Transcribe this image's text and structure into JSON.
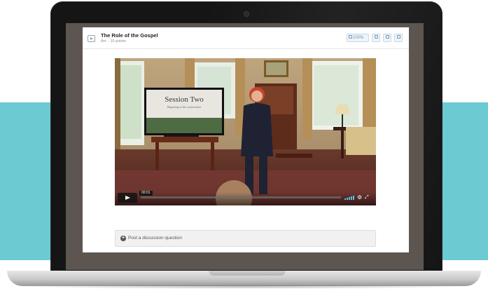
{
  "colors": {
    "teal_band": "#6ccad3",
    "laptop_bezel": "#151515",
    "accent_blue": "#6b96bb",
    "volume_blue": "#4fc3e6"
  },
  "lesson": {
    "title": "The Role of the Gospel",
    "duration": "8m",
    "separator": "·",
    "points": "10 points",
    "icon": "video-icon"
  },
  "toolbar": {
    "zoom_label": "100%",
    "zoom_icon": "expand-icon",
    "buttons": [
      "notes-icon",
      "bookmark-icon",
      "layout-icon"
    ]
  },
  "video": {
    "slide_title": "Session Two",
    "slide_subtitle": "Beginning of the conversation",
    "current_time": "00:01",
    "progress": 0.0,
    "volume_icon": "volume-icon",
    "settings_icon": "gear-icon",
    "fullscreen_icon": "fullscreen-icon"
  },
  "discussion": {
    "placeholder": "Post a discussion question",
    "icon": "plus-circle-icon"
  }
}
